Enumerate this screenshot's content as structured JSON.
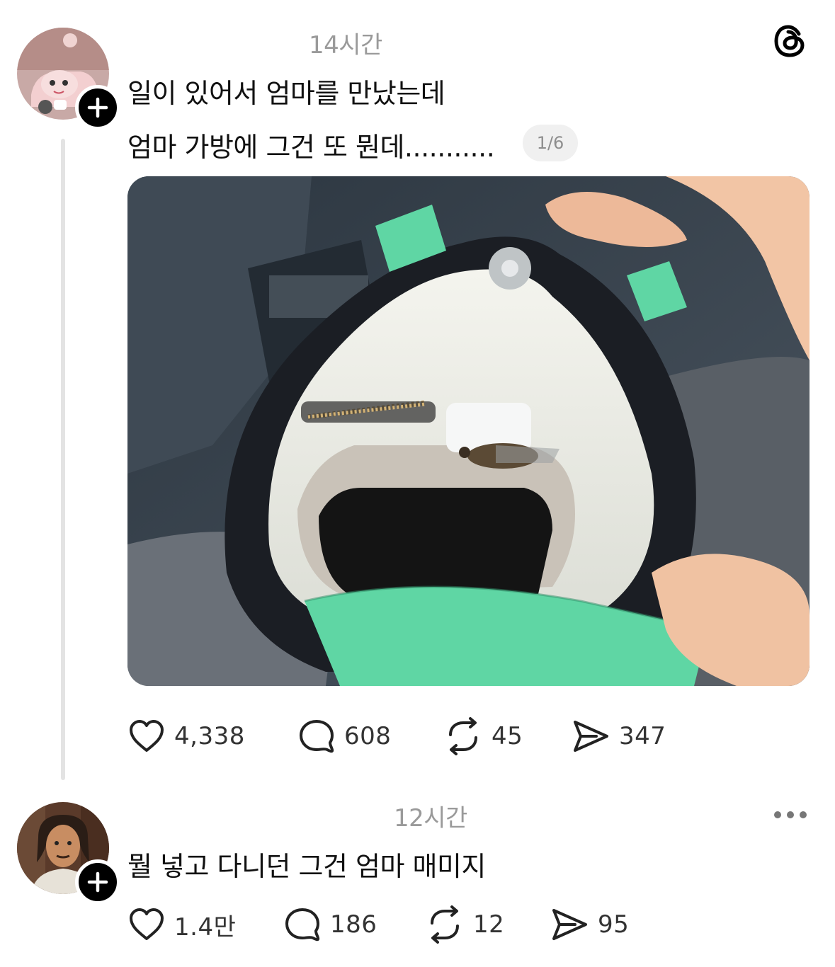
{
  "posts": [
    {
      "time": "14시간",
      "text_lines": [
        "일이 있어서 엄마를 만났는데",
        "엄마 가방에 그건 또 뭔데..........."
      ],
      "media_counter": "1/6",
      "actions": {
        "likes": "4,338",
        "comments": "608",
        "reposts": "45",
        "shares": "347"
      }
    },
    {
      "time": "12시간",
      "text_lines": [
        "뭘 넣고 다니던 그건 엄마 매미지"
      ],
      "actions": {
        "likes": "1.4만",
        "comments": "186",
        "reposts": "12",
        "shares": "95"
      }
    }
  ],
  "icons": {
    "app_logo": "threads-icon",
    "follow": "plus-icon",
    "like": "heart-icon",
    "comment": "comment-bubble-icon",
    "repost": "repost-icon",
    "share": "send-icon",
    "more": "more-horizontal-icon"
  },
  "colors": {
    "bag_accent": "#5fd6a4",
    "muted_text": "#9a9a9a",
    "thread_line": "#e3e3e3"
  }
}
